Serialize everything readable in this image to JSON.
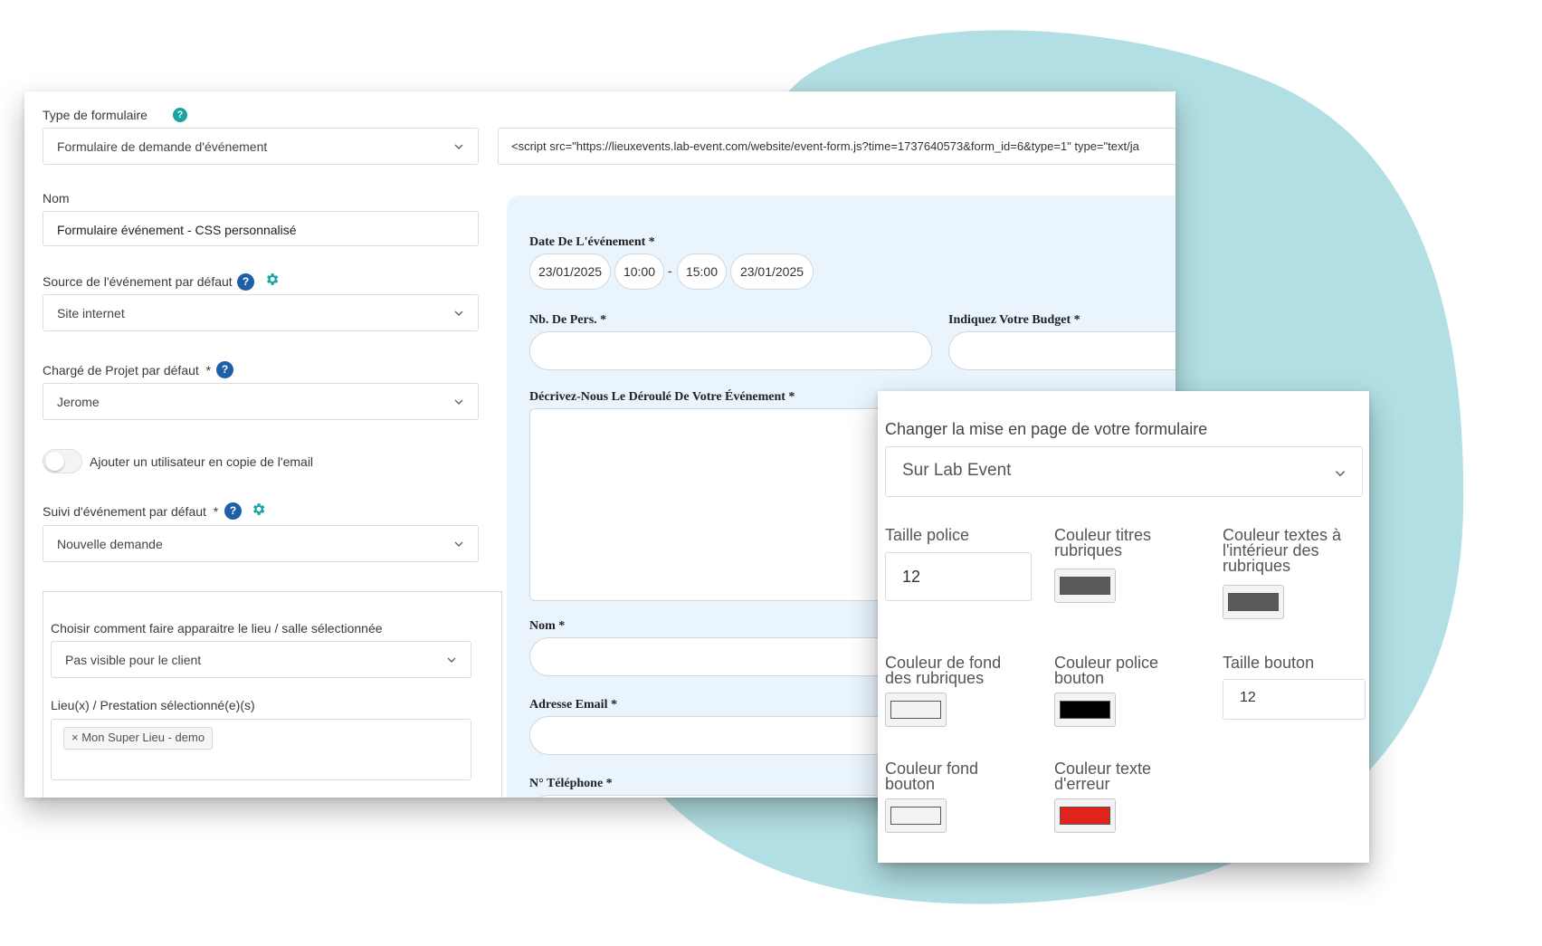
{
  "form_settings": {
    "type_label": "Type de formulaire",
    "type_value": "Formulaire de demande d'événement",
    "embed_code": "<script src=\"https://lieuxevents.lab-event.com/website/event-form.js?time=1737640573&form_id=6&type=1\" type=\"text/ja",
    "name_label": "Nom",
    "name_value": "Formulaire événement - CSS personnalisé",
    "source_label": "Source de l'événement par défaut",
    "source_value": "Site internet",
    "manager_label": "Chargé de Projet par défaut",
    "manager_required": "*",
    "manager_value": "Jerome",
    "copy_toggle_label": "Ajouter un utilisateur en copie de l'email",
    "followup_label": "Suivi d'événement par défaut",
    "followup_required": "*",
    "followup_value": "Nouvelle demande",
    "venue_display_label": "Choisir comment faire apparaitre le lieu / salle sélectionnée",
    "venue_display_value": "Pas visible pour le client",
    "venues_label": "Lieu(x) / Prestation sélectionné(e)(s)",
    "venue_tag": "Mon Super Lieu - demo",
    "tag_remove": "×",
    "help_symbol": "?"
  },
  "preview": {
    "date_label": "Date De L'événement *",
    "start_date": "23/01/2025",
    "start_time": "10:00",
    "separator": "-",
    "end_time": "15:00",
    "end_date": "23/01/2025",
    "guests_label": "Nb. De Pers. *",
    "budget_label": "Indiquez Votre Budget *",
    "description_label": "Décrivez-Nous Le Déroulé De Votre Événement *",
    "name_label": "Nom *",
    "email_label": "Adresse Email *",
    "phone_label": "N° Téléphone *"
  },
  "layout_panel": {
    "title": "Changer la mise en page de votre formulaire",
    "layout_value": "Sur Lab Event",
    "font_size_label": "Taille police",
    "font_size_value": "12",
    "heading_color_label": "Couleur titres rubriques",
    "text_color_label": "Couleur textes à l'intérieur des rubriques",
    "bg_color_label": "Couleur de fond des rubriques",
    "button_font_color_label": "Couleur police bouton",
    "button_size_label": "Taille bouton",
    "button_size_value": "12",
    "button_bg_color_label": "Couleur fond bouton",
    "error_color_label": "Couleur texte d'erreur"
  },
  "colors": {
    "accent_blue": "#1f5fa8",
    "teal": "#1aa3a3",
    "blob": "#b2dfe3",
    "heading_color": "#5a5a5a",
    "text_color": "#5a5a5a",
    "bg_color": "#f3f3f3",
    "button_font_color": "#000000",
    "button_bg_color": "#f3f3f3",
    "error_color": "#e0231d"
  }
}
